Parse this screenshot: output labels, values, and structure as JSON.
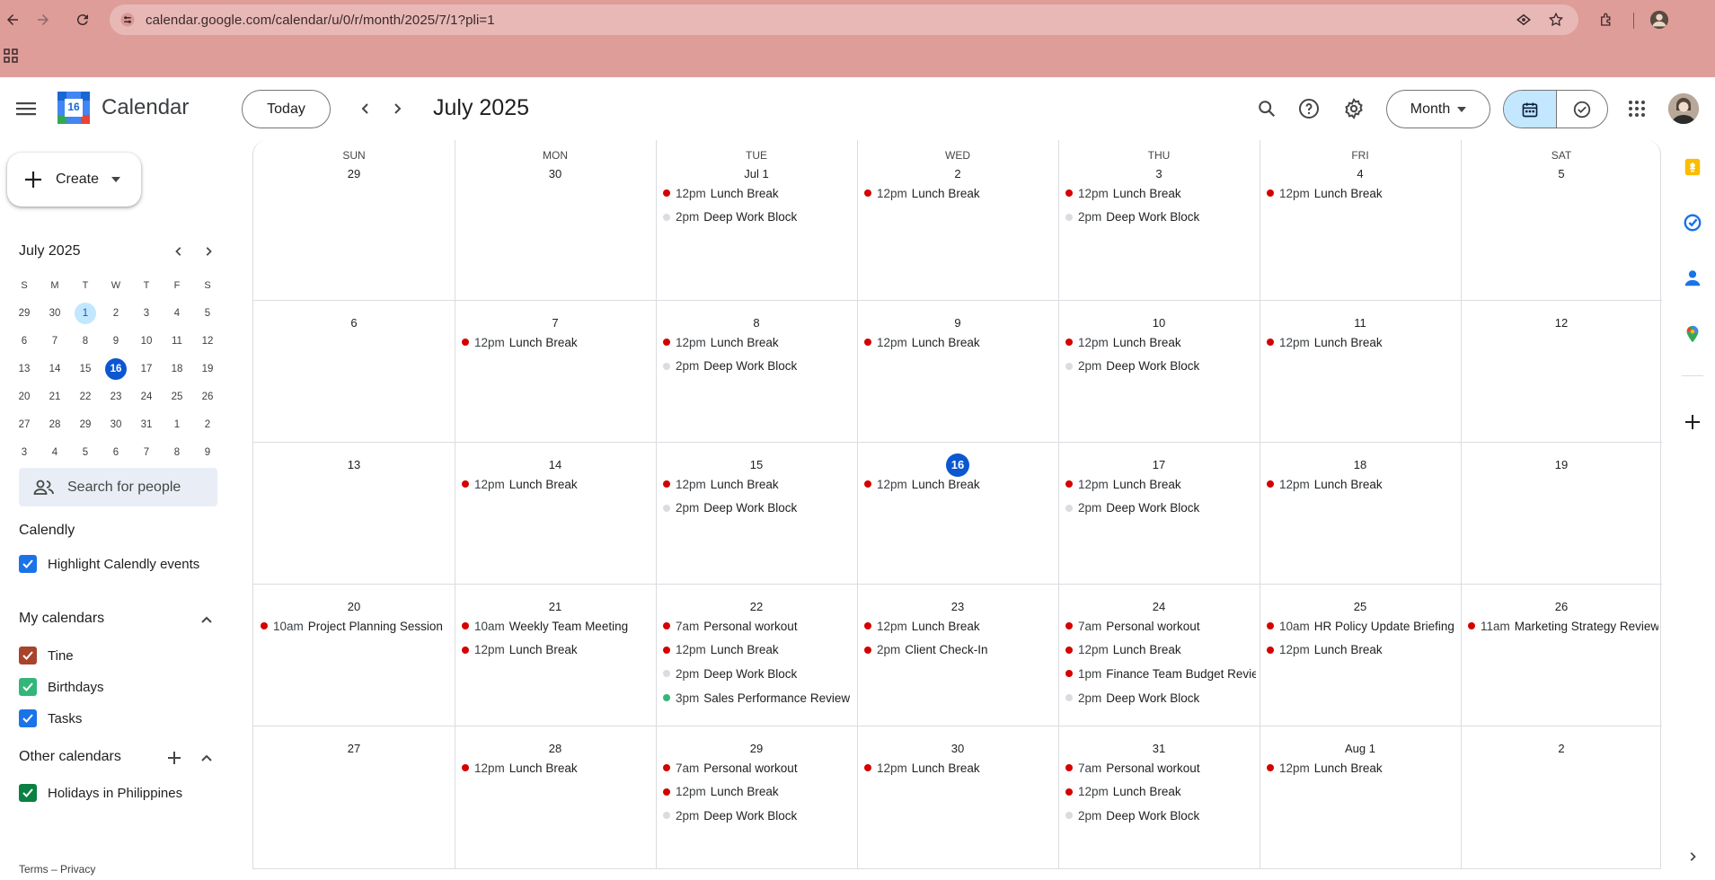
{
  "browser": {
    "url": "calendar.google.com/calendar/u/0/r/month/2025/7/1?pli=1"
  },
  "header": {
    "app_title": "Calendar",
    "logo_number": "16",
    "today_label": "Today",
    "month_title": "July 2025",
    "view_label": "Month"
  },
  "sidebar": {
    "create_label": "Create",
    "mini_title": "July 2025",
    "weekday_initials": [
      "S",
      "M",
      "T",
      "W",
      "T",
      "F",
      "S"
    ],
    "weeks": [
      [
        "29",
        "30",
        "1",
        "2",
        "3",
        "4",
        "5"
      ],
      [
        "6",
        "7",
        "8",
        "9",
        "10",
        "11",
        "12"
      ],
      [
        "13",
        "14",
        "15",
        "16",
        "17",
        "18",
        "19"
      ],
      [
        "20",
        "21",
        "22",
        "23",
        "24",
        "25",
        "26"
      ],
      [
        "27",
        "28",
        "29",
        "30",
        "31",
        "1",
        "2"
      ],
      [
        "3",
        "4",
        "5",
        "6",
        "7",
        "8",
        "9"
      ]
    ],
    "search_people": "Search for people",
    "calendly_title": "Calendly",
    "calendly_item": "Highlight Calendly events",
    "my_calendars_title": "My calendars",
    "my_calendars": [
      {
        "label": "Tine",
        "color": "#a8432c"
      },
      {
        "label": "Birthdays",
        "color": "#33b679"
      },
      {
        "label": "Tasks",
        "color": "#1a73e8"
      }
    ],
    "other_calendars_title": "Other calendars",
    "other_calendars": [
      {
        "label": "Holidays in Philippines",
        "color": "#0b8043"
      }
    ],
    "footer": "Terms – Privacy"
  },
  "grid": {
    "col_heads": [
      "SUN",
      "MON",
      "TUE",
      "WED",
      "THU",
      "FRI",
      "SAT"
    ],
    "weeks": [
      {
        "days": [
          {
            "label": "29",
            "events": []
          },
          {
            "label": "30",
            "events": []
          },
          {
            "label": "Jul 1",
            "events": [
              {
                "time": "12pm",
                "name": "Lunch Break",
                "color": "#d50000"
              },
              {
                "time": "2pm",
                "name": "Deep Work Block",
                "color": "#dadce0"
              }
            ]
          },
          {
            "label": "2",
            "events": [
              {
                "time": "12pm",
                "name": "Lunch Break",
                "color": "#d50000"
              }
            ]
          },
          {
            "label": "3",
            "events": [
              {
                "time": "12pm",
                "name": "Lunch Break",
                "color": "#d50000"
              },
              {
                "time": "2pm",
                "name": "Deep Work Block",
                "color": "#dadce0"
              }
            ]
          },
          {
            "label": "4",
            "events": [
              {
                "time": "12pm",
                "name": "Lunch Break",
                "color": "#d50000"
              }
            ]
          },
          {
            "label": "5",
            "events": []
          }
        ]
      },
      {
        "days": [
          {
            "label": "6",
            "events": []
          },
          {
            "label": "7",
            "events": [
              {
                "time": "12pm",
                "name": "Lunch Break",
                "color": "#d50000"
              }
            ]
          },
          {
            "label": "8",
            "events": [
              {
                "time": "12pm",
                "name": "Lunch Break",
                "color": "#d50000"
              },
              {
                "time": "2pm",
                "name": "Deep Work Block",
                "color": "#dadce0"
              }
            ]
          },
          {
            "label": "9",
            "events": [
              {
                "time": "12pm",
                "name": "Lunch Break",
                "color": "#d50000"
              }
            ]
          },
          {
            "label": "10",
            "events": [
              {
                "time": "12pm",
                "name": "Lunch Break",
                "color": "#d50000"
              },
              {
                "time": "2pm",
                "name": "Deep Work Block",
                "color": "#dadce0"
              }
            ]
          },
          {
            "label": "11",
            "events": [
              {
                "time": "12pm",
                "name": "Lunch Break",
                "color": "#d50000"
              }
            ]
          },
          {
            "label": "12",
            "events": []
          }
        ]
      },
      {
        "days": [
          {
            "label": "13",
            "events": []
          },
          {
            "label": "14",
            "events": [
              {
                "time": "12pm",
                "name": "Lunch Break",
                "color": "#d50000"
              }
            ]
          },
          {
            "label": "15",
            "events": [
              {
                "time": "12pm",
                "name": "Lunch Break",
                "color": "#d50000"
              },
              {
                "time": "2pm",
                "name": "Deep Work Block",
                "color": "#dadce0"
              }
            ]
          },
          {
            "label": "16",
            "today": true,
            "events": [
              {
                "time": "12pm",
                "name": "Lunch Break",
                "color": "#d50000"
              }
            ]
          },
          {
            "label": "17",
            "events": [
              {
                "time": "12pm",
                "name": "Lunch Break",
                "color": "#d50000"
              },
              {
                "time": "2pm",
                "name": "Deep Work Block",
                "color": "#dadce0"
              }
            ]
          },
          {
            "label": "18",
            "events": [
              {
                "time": "12pm",
                "name": "Lunch Break",
                "color": "#d50000"
              }
            ]
          },
          {
            "label": "19",
            "events": []
          }
        ]
      },
      {
        "days": [
          {
            "label": "20",
            "events": [
              {
                "time": "10am",
                "name": "Project Planning Session",
                "color": "#d50000"
              }
            ]
          },
          {
            "label": "21",
            "events": [
              {
                "time": "10am",
                "name": "Weekly Team Meeting",
                "color": "#d50000"
              },
              {
                "time": "12pm",
                "name": "Lunch Break",
                "color": "#d50000"
              }
            ]
          },
          {
            "label": "22",
            "events": [
              {
                "time": "7am",
                "name": "Personal workout",
                "color": "#d50000"
              },
              {
                "time": "12pm",
                "name": "Lunch Break",
                "color": "#d50000"
              },
              {
                "time": "2pm",
                "name": "Deep Work Block",
                "color": "#dadce0"
              },
              {
                "time": "3pm",
                "name": "Sales Performance Review",
                "color": "#33b679"
              }
            ]
          },
          {
            "label": "23",
            "events": [
              {
                "time": "12pm",
                "name": "Lunch Break",
                "color": "#d50000"
              },
              {
                "time": "2pm",
                "name": "Client Check-In",
                "color": "#d50000"
              }
            ]
          },
          {
            "label": "24",
            "events": [
              {
                "time": "7am",
                "name": "Personal workout",
                "color": "#d50000"
              },
              {
                "time": "12pm",
                "name": "Lunch Break",
                "color": "#d50000"
              },
              {
                "time": "1pm",
                "name": "Finance Team Budget Review",
                "color": "#d50000"
              },
              {
                "time": "2pm",
                "name": "Deep Work Block",
                "color": "#dadce0"
              }
            ]
          },
          {
            "label": "25",
            "events": [
              {
                "time": "10am",
                "name": "HR Policy Update Briefing",
                "color": "#d50000"
              },
              {
                "time": "12pm",
                "name": "Lunch Break",
                "color": "#d50000"
              }
            ]
          },
          {
            "label": "26",
            "events": [
              {
                "time": "11am",
                "name": "Marketing Strategy Review",
                "color": "#d50000"
              }
            ]
          }
        ]
      },
      {
        "days": [
          {
            "label": "27",
            "events": []
          },
          {
            "label": "28",
            "events": [
              {
                "time": "12pm",
                "name": "Lunch Break",
                "color": "#d50000"
              }
            ]
          },
          {
            "label": "29",
            "events": [
              {
                "time": "7am",
                "name": "Personal workout",
                "color": "#d50000"
              },
              {
                "time": "12pm",
                "name": "Lunch Break",
                "color": "#d50000"
              },
              {
                "time": "2pm",
                "name": "Deep Work Block",
                "color": "#dadce0"
              }
            ]
          },
          {
            "label": "30",
            "events": [
              {
                "time": "12pm",
                "name": "Lunch Break",
                "color": "#d50000"
              }
            ]
          },
          {
            "label": "31",
            "events": [
              {
                "time": "7am",
                "name": "Personal workout",
                "color": "#d50000"
              },
              {
                "time": "12pm",
                "name": "Lunch Break",
                "color": "#d50000"
              },
              {
                "time": "2pm",
                "name": "Deep Work Block",
                "color": "#dadce0"
              }
            ]
          },
          {
            "label": "Aug 1",
            "events": [
              {
                "time": "12pm",
                "name": "Lunch Break",
                "color": "#d50000"
              }
            ]
          },
          {
            "label": "2",
            "events": []
          }
        ]
      }
    ]
  },
  "right_rail": [
    "keep-icon",
    "tasks-icon",
    "contacts-icon",
    "maps-icon",
    "add-icon"
  ]
}
